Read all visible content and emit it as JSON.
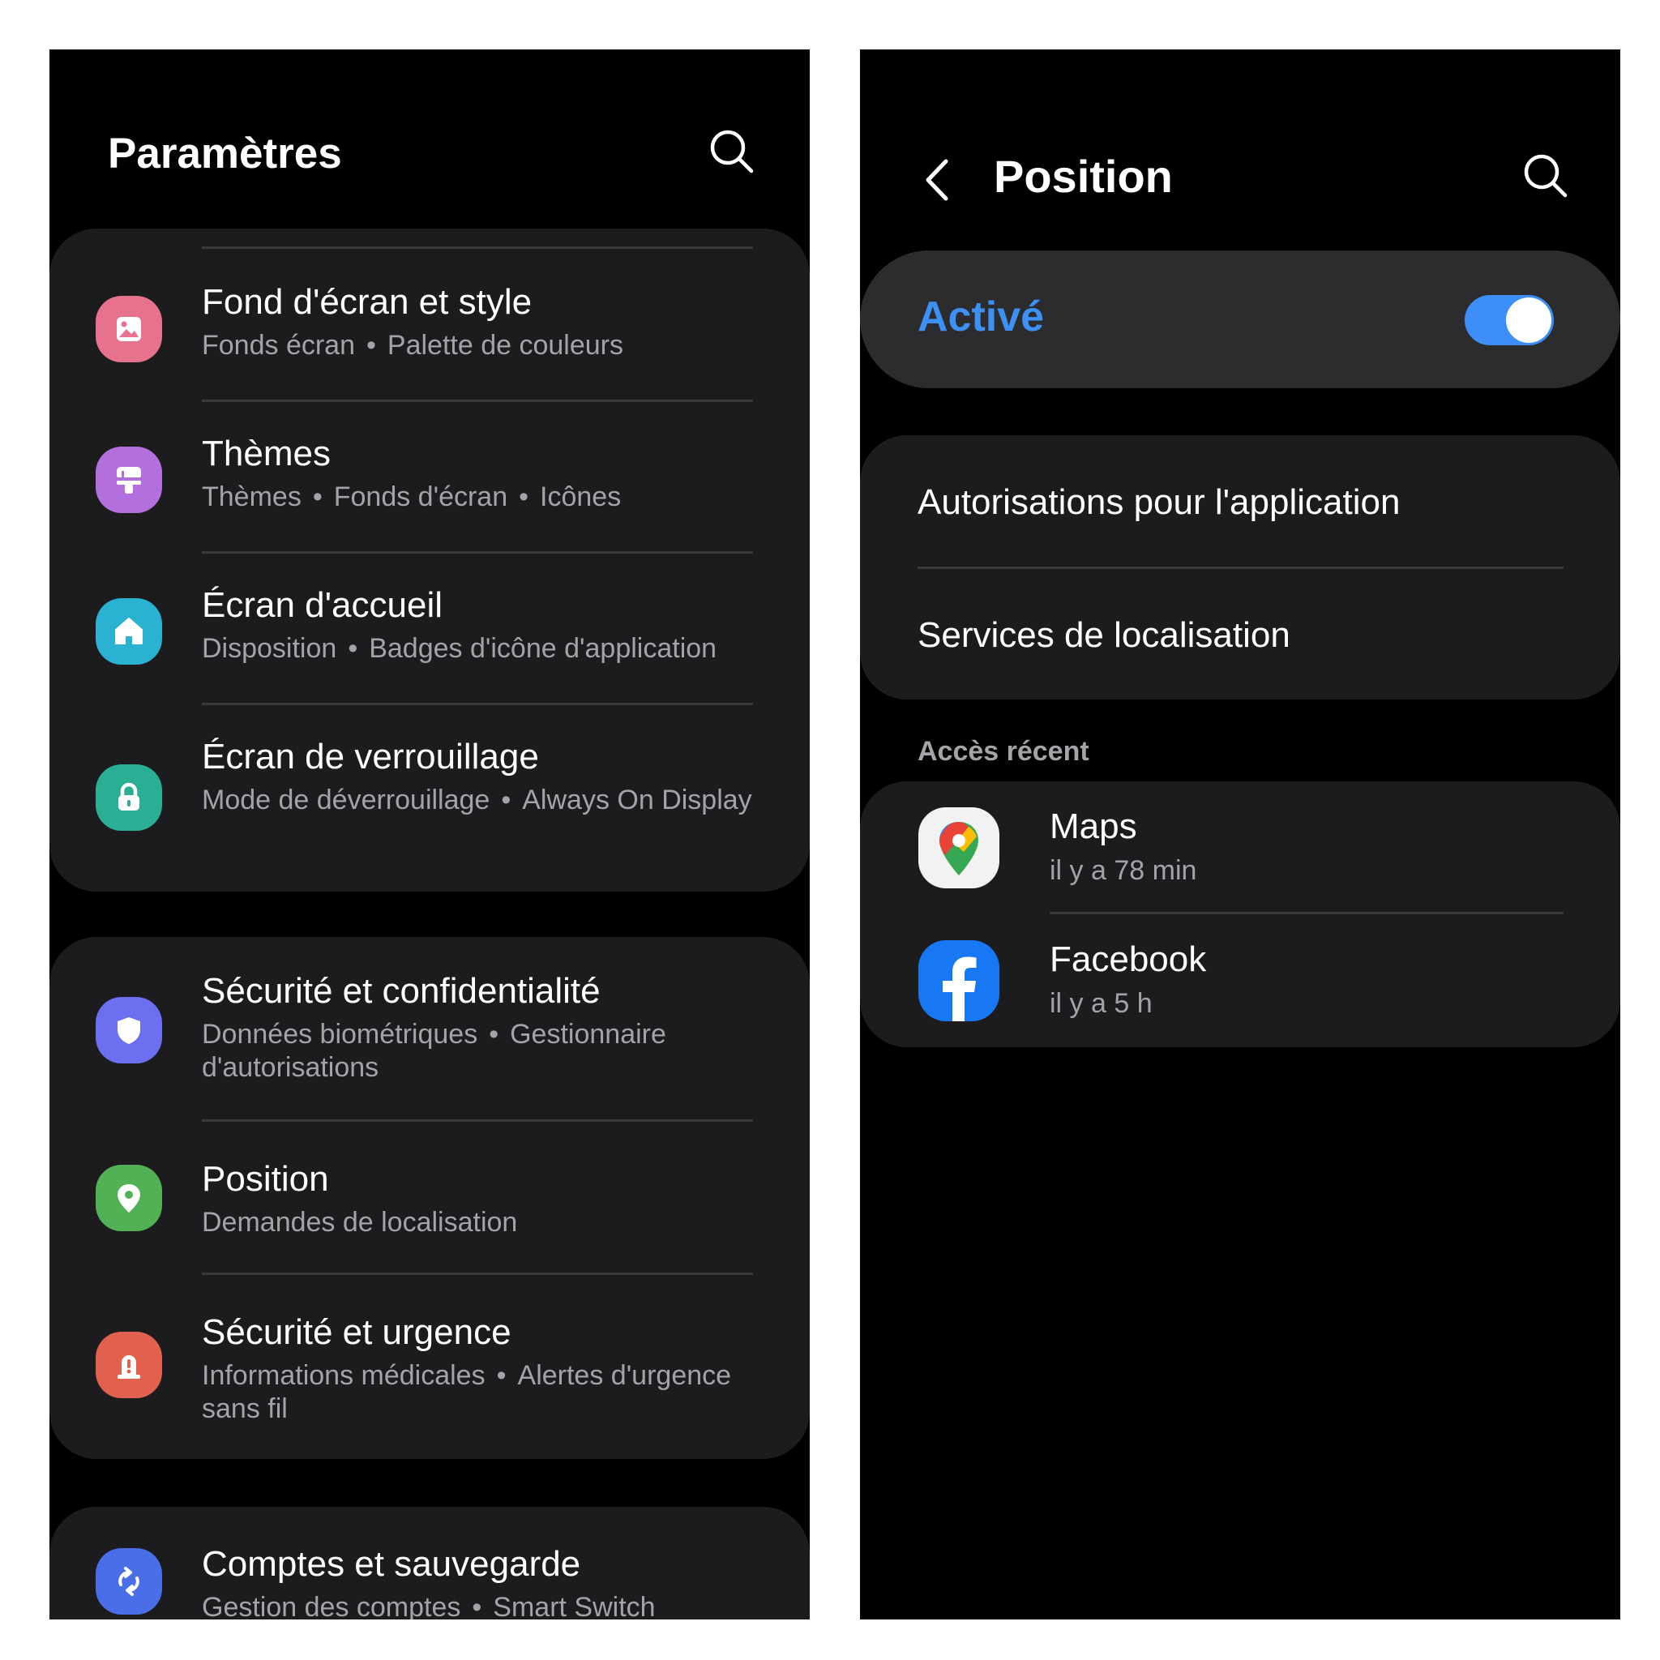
{
  "left": {
    "title": "Paramètres",
    "groups": [
      {
        "items": [
          {
            "title": "Fond d'écran et style",
            "parts": [
              "Fonds écran",
              "Palette de couleurs"
            ],
            "icon": "wallpaper-icon",
            "color": "#e7728d"
          },
          {
            "title": "Thèmes",
            "parts": [
              "Thèmes",
              "Fonds d'écran",
              "Icônes"
            ],
            "icon": "paint-brush-icon",
            "color": "#b36fdc"
          },
          {
            "title": "Écran d'accueil",
            "parts": [
              "Disposition",
              "Badges d'icône d'application"
            ],
            "icon": "home-icon",
            "color": "#2bb2d2"
          },
          {
            "title": "Écran de verrouillage",
            "parts": [
              "Mode de déverrouillage",
              "Always On Display"
            ],
            "icon": "lock-icon",
            "color": "#2aae94"
          }
        ]
      },
      {
        "items": [
          {
            "title": "Sécurité et confidentialité",
            "parts": [
              "Données biométriques",
              "Gestionnaire d'autorisations"
            ],
            "icon": "shield-icon",
            "color": "#6b6ff0"
          },
          {
            "title": "Position",
            "parts": [
              "Demandes de localisation"
            ],
            "icon": "location-pin-icon",
            "color": "#52b055"
          },
          {
            "title": "Sécurité et urgence",
            "parts": [
              "Informations médicales",
              "Alertes d'urgence sans fil"
            ],
            "icon": "emergency-icon",
            "color": "#e2614e"
          }
        ]
      },
      {
        "items": [
          {
            "title": "Comptes et sauvegarde",
            "parts": [
              "Gestion des comptes",
              "Smart Switch"
            ],
            "icon": "sync-icon",
            "color": "#4a6ee8"
          }
        ]
      }
    ]
  },
  "right": {
    "title": "Position",
    "toggle": {
      "label": "Activé",
      "on": true,
      "color": "#3e91f4"
    },
    "menu": [
      "Autorisations pour l'application",
      "Services de localisation"
    ],
    "section_label": "Accès récent",
    "recent": [
      {
        "name": "Maps",
        "time": "il y a 78 min",
        "icon": "google-maps-icon"
      },
      {
        "name": "Facebook",
        "time": "il y a 5 h",
        "icon": "facebook-icon"
      }
    ]
  }
}
